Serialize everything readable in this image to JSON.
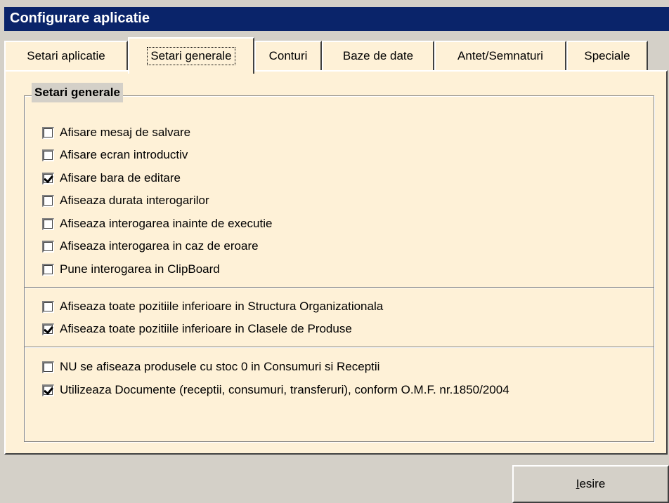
{
  "window": {
    "title": "Configurare aplicatie"
  },
  "tabs": [
    {
      "label": "Setari aplicatie"
    },
    {
      "label": "Setari generale"
    },
    {
      "label": "Conturi"
    },
    {
      "label": "Baze de date"
    },
    {
      "label": "Antet/Semnaturi"
    },
    {
      "label": "Speciale"
    }
  ],
  "active_tab": "Setari generale",
  "group": {
    "title": "Setari generale"
  },
  "options": [
    {
      "label": "Afisare mesaj de salvare",
      "checked": false
    },
    {
      "label": "Afisare ecran introductiv",
      "checked": false
    },
    {
      "label": "Afisare bara de editare",
      "checked": true
    },
    {
      "label": "Afiseaza durata interogarilor",
      "checked": false
    },
    {
      "label": "Afiseaza interogarea inainte de executie",
      "checked": false
    },
    {
      "label": "Afiseaza interogarea in caz de eroare",
      "checked": false
    },
    {
      "label": "Pune interogarea in ClipBoard",
      "checked": false
    },
    {
      "label": "Afiseaza toate pozitiile inferioare in Structura Organizationala",
      "checked": false
    },
    {
      "label": "Afiseaza toate pozitiile inferioare in Clasele de Produse",
      "checked": true
    },
    {
      "label": "NU se afiseaza produsele cu stoc 0 in Consumuri si Receptii",
      "checked": false
    },
    {
      "label": "Utilizeaza Documente (receptii, consumuri, transferuri), conform O.M.F. nr.1850/2004",
      "checked": true
    }
  ],
  "footer": {
    "exit_first": "I",
    "exit_rest": "esire"
  },
  "colors": {
    "titlebar": "#0a246a",
    "panel": "#fef1d7",
    "chrome": "#d4d0c8"
  }
}
